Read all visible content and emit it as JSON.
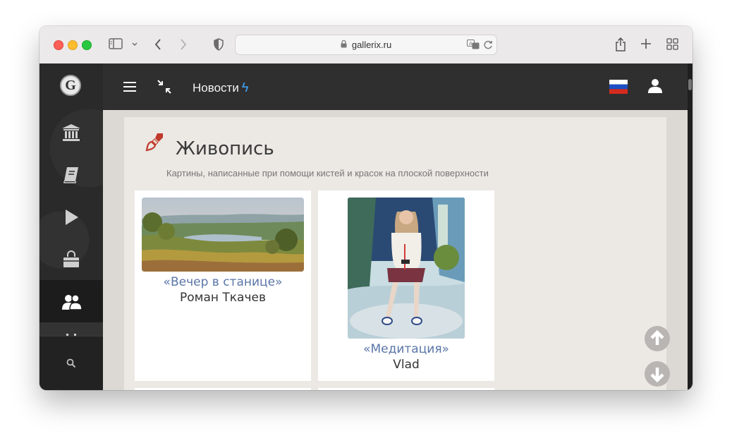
{
  "browser": {
    "url": "gallerix.ru"
  },
  "topbar": {
    "news_label": "Новости"
  },
  "category": {
    "title": "Живопись",
    "description": "Картины, написанные при помощи кистей и красок на плоской поверхности"
  },
  "artworks": [
    {
      "title": "«Вечер в станице»",
      "author": "Роман Ткачев"
    },
    {
      "title": "«Медитация»",
      "author": "Vlad"
    }
  ],
  "colors": {
    "accent_link": "#5a75a8",
    "bolt": "#3fa7ff",
    "brush": "#c0392b"
  }
}
